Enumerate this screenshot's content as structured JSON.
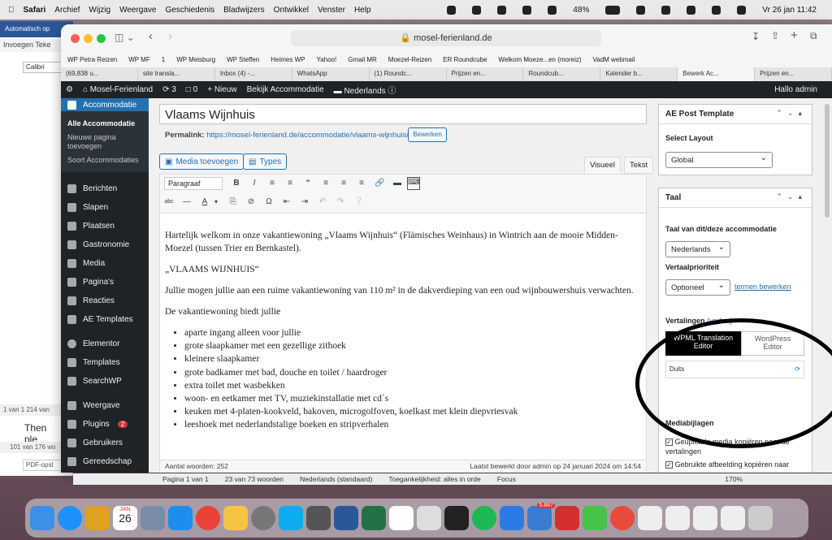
{
  "menubar": {
    "app": "Safari",
    "items": [
      "Archief",
      "Wijzig",
      "Weergave",
      "Geschiedenis",
      "Bladwijzers",
      "Ontwikkel",
      "Venster",
      "Help"
    ],
    "battery": "48%",
    "clock": "Vr 26 jan 11:42"
  },
  "word": {
    "title": "Automatisch op",
    "tabs": "Invoegen   Teke",
    "font": "Calibri",
    "status1": "1 van 1   214 van",
    "then": "Then ple",
    "status2": "101 van 176 wo",
    "pdf": "PDF-opsl"
  },
  "safari": {
    "url": "mosel-ferienland.de",
    "favorites": [
      "WP Petra Reizen",
      "WP MF",
      "1",
      "WP Meisburg",
      "WP Steffen",
      "Heimes WP",
      "Yahoo!",
      "Gmail MR",
      "Moezel-Reizen",
      "ER Roundcube",
      "Welkom Moeze...en (moreiz)",
      "VadM webmail"
    ],
    "tabs": [
      "(69,838 u...",
      "site transla...",
      "Inbox (4) -...",
      "WhatsApp",
      "(1) Roundc...",
      "Prijzen en...",
      "Roundcub...",
      "Kalender b...",
      "Bewerk Ac...",
      "Prijzen en..."
    ]
  },
  "adminbar": {
    "site": "Mosel-Ferienland",
    "updates": "3",
    "comments": "0",
    "new": "Nieuw",
    "view": "Bekijk Accommodatie",
    "lang": "Nederlands",
    "greeting": "Hallo admin"
  },
  "sidebar": {
    "current": "Accommodatie",
    "sub": [
      "Alle Accommodatie",
      "Nieuwe pagina toevoegen",
      "Soort Accommodaties"
    ],
    "items": [
      "Berichten",
      "Slapen",
      "Plaatsen",
      "Gastronomie",
      "Media",
      "Pagina's",
      "Reacties",
      "AE Templates",
      "Elementor",
      "Templates",
      "SearchWP",
      "Weergave",
      "Plugins",
      "Gebruikers",
      "Gereedschap"
    ],
    "plugins_badge": "2"
  },
  "editor": {
    "title": "Vlaams Wijnhuis",
    "permalink_label": "Permalink:",
    "permalink_url": "https://mosel-ferienland.de/accommodatie/vlaams-wijnhuis/",
    "permalink_btn": "Bewerken",
    "media_btn": "Media toevoegen",
    "types_btn": "Types",
    "tab_visual": "Visueel",
    "tab_text": "Tekst",
    "format": "Paragraaf",
    "p1": "Hartelijk welkom in onze vakantiewoning „Vlaams Wijnhuis“ (Flämisches Weinhaus) in Wintrich  aan de mooie Midden-Moezel (tussen Trier en Bernkastel).",
    "p2": "„VLAAMS WIJNHUIS“",
    "p3": "Jullie mogen jullie aan een ruime vakantiewoning van 110 m² in de dakverdieping van een oud wijnbouwershuis verwachten.",
    "p4": "De vakantiewoning biedt jullie",
    "list": [
      "aparte ingang alleen voor jullie",
      "grote slaapkamer met een gezellige zithoek",
      "kleinere slaapkamer",
      "grote badkamer met bad, douche en toilet / haardroger",
      "extra toilet met wasbekken",
      "woon- en eetkamer met TV, muziekinstallatie met cd´s",
      "keuken met 4-platen-kookveld, bakoven, microgolfoven, koelkast met klein diepvriesvak",
      "leeshoek met nederlandstalige boeken en stripverhalen"
    ],
    "wordcount": "Aantal woorden: 252",
    "lastedit": "Laatst bewerkt door admin op 24 januari 2024 om 14:54"
  },
  "ae_box": {
    "title": "AE Post Template",
    "label": "Select Layout",
    "value": "Global"
  },
  "taal_box": {
    "title": "Taal",
    "lang_label": "Taal van dit/deze accommodatie",
    "lang_value": "Nederlands",
    "prio_label": "Vertaalprioriteit",
    "prio_value": "Optioneel",
    "prio_link": "termen bewerken",
    "vert_label": "Vertalingen",
    "vert_link": "(verb...)",
    "tab_wpml": "WPML Translation Editor",
    "tab_wp": "WordPress Editor",
    "lang_row": "Duits",
    "media_title": "Mediabijlagen",
    "cb1": "Geüploade media kopiëren naar de vertalingen",
    "cb2": "Gebruikte afbeelding kopiëren naar"
  },
  "wordbar": {
    "page": "Pagina 1 van 1",
    "words": "23 van 73 woorden",
    "lang": "Nederlands (standaard)",
    "access": "Toegankelijkheid: alles in orde",
    "focus": "Focus",
    "zoom": "170%"
  },
  "dock": {
    "calendar_month": "JAN",
    "calendar_day": "26",
    "mail_badge": "5.867"
  }
}
